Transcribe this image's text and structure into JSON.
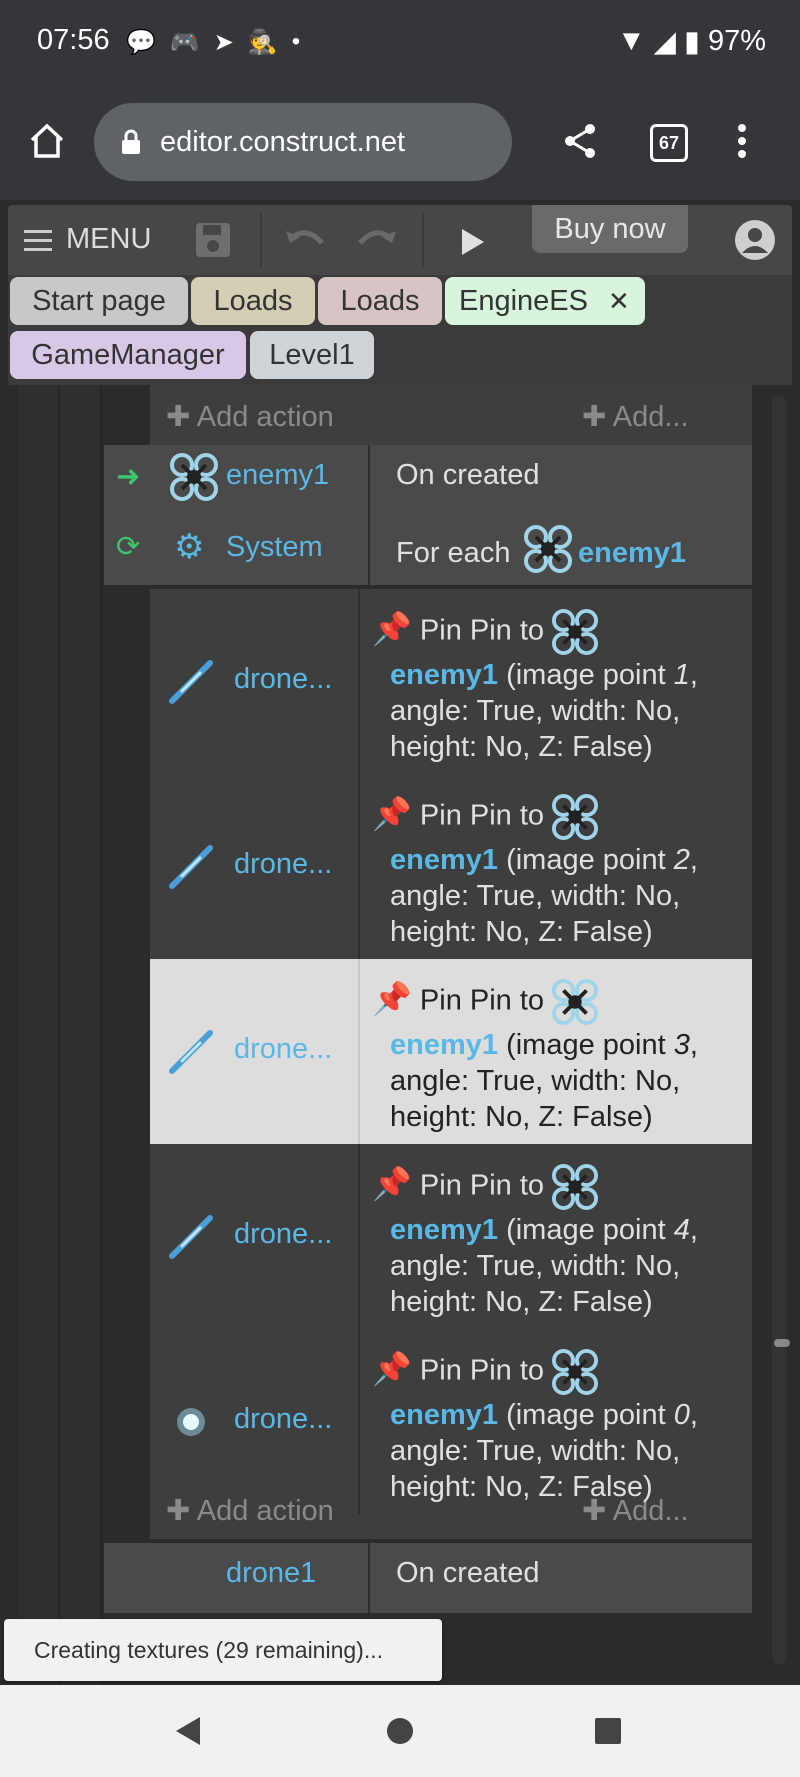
{
  "statusbar": {
    "time": "07:56",
    "battery": "97%"
  },
  "browser": {
    "url": "editor.construct.net",
    "tab_count": "67"
  },
  "toolbar": {
    "menu_label": "MENU",
    "buy_label": "Buy now"
  },
  "tabs": [
    {
      "label": "Start page"
    },
    {
      "label": "Loads"
    },
    {
      "label": "Loads"
    },
    {
      "label": "EngineES"
    },
    {
      "label": "GameManager"
    },
    {
      "label": "Level1"
    }
  ],
  "sheet": {
    "add_action": "Add action",
    "add_more": "Add...",
    "event1": {
      "cond1_object": "enemy1",
      "cond1_text": "On created",
      "cond2_object": "System",
      "cond2_text_prefix": "For each",
      "cond2_target": "enemy1"
    },
    "actions": [
      {
        "object": "drone...",
        "line1": "Pin Pin to",
        "target": "enemy1",
        "line2_rest": "(image point ",
        "point": "1",
        "line3": "angle: True, width: No,",
        "line4": "height: No, Z: False)"
      },
      {
        "object": "drone...",
        "line1": "Pin Pin to",
        "target": "enemy1",
        "line2_rest": "(image point ",
        "point": "2",
        "line3": "angle: True, width: No,",
        "line4": "height: No, Z: False)"
      },
      {
        "object": "drone...",
        "line1": "Pin Pin to",
        "target": "enemy1",
        "line2_rest": "(image point ",
        "point": "3",
        "line3": "angle: True, width: No,",
        "line4": "height: No, Z: False)"
      },
      {
        "object": "drone...",
        "line1": "Pin Pin to",
        "target": "enemy1",
        "line2_rest": "(image point ",
        "point": "4",
        "line3": "angle: True, width: No,",
        "line4": "height: No, Z: False)"
      },
      {
        "object": "drone...",
        "line1": "Pin Pin to",
        "target": "enemy1",
        "line2_rest": "(image point ",
        "point": "0",
        "line3": "angle: True, width: No,",
        "line4": "height: No, Z: False)"
      }
    ],
    "next_event": {
      "object": "drone1",
      "text": "On created"
    }
  },
  "toast": "Creating textures (29 remaining)...",
  "colors": {
    "accent_blue": "#5ab8e6",
    "pin_red": "#e8504a",
    "active_tab": "#d6f5dc"
  }
}
